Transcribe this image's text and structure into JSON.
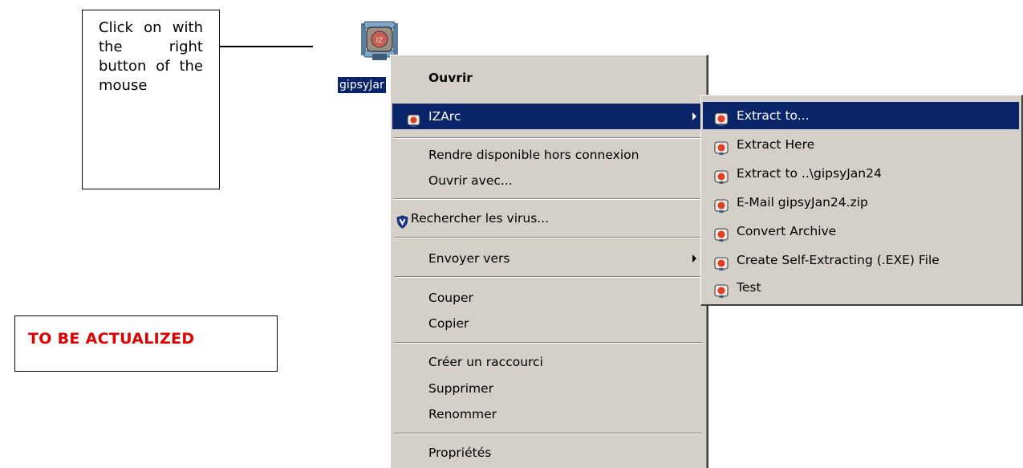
{
  "callout": {
    "text": "Click on with the right button of the mouse"
  },
  "todo": {
    "text": "TO BE ACTUALIZED",
    "color": "#e00000"
  },
  "desktop": {
    "file_label": "gipsyJar",
    "file_icon": "izarc-archive-icon"
  },
  "context_menu": {
    "items": [
      {
        "label": "Ouvrir",
        "bold": true
      },
      {
        "label": "IZArc",
        "icon": "izarc-icon",
        "has_submenu": true,
        "highlighted": true
      },
      {
        "label": "Rendre disponible hors connexion"
      },
      {
        "label": "Ouvrir avec..."
      },
      {
        "label": "Rechercher les virus...",
        "icon": "antivirus-shield-icon"
      },
      {
        "label": "Envoyer vers",
        "has_submenu": true
      },
      {
        "label": "Couper"
      },
      {
        "label": "Copier"
      },
      {
        "label": "Créer un raccourci"
      },
      {
        "label": "Supprimer"
      },
      {
        "label": "Renommer"
      },
      {
        "label": "Propriétés"
      }
    ]
  },
  "submenu": {
    "items": [
      {
        "label": "Extract to...",
        "icon": "izarc-icon",
        "highlighted": true
      },
      {
        "label": "Extract Here",
        "icon": "izarc-icon"
      },
      {
        "label": "Extract to ..\\gipsyJan24",
        "icon": "izarc-icon"
      },
      {
        "label": "E-Mail gipsyJan24.zip",
        "icon": "izarc-icon"
      },
      {
        "label": "Convert Archive",
        "icon": "izarc-icon"
      },
      {
        "label": "Create Self-Extracting (.EXE) File",
        "icon": "izarc-icon"
      },
      {
        "label": "Test",
        "icon": "izarc-icon"
      }
    ]
  },
  "colors": {
    "menu_bg": "#d4d0c8",
    "highlight": "#0a246a",
    "highlight_text": "#ffffff"
  }
}
